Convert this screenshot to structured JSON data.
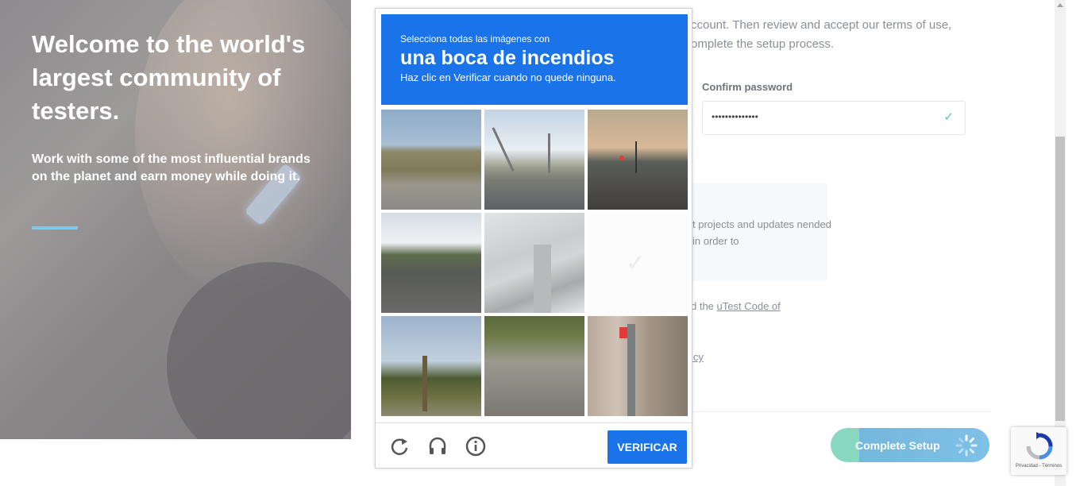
{
  "hero": {
    "title": "Welcome to the world's largest community of testers.",
    "subtitle": "Work with some of the most influential brands on the planet and earn money while doing it."
  },
  "form": {
    "intro": "ccount. Then review and accept our terms of use, omplete the setup process.",
    "confirm_password_label": "Confirm password",
    "confirm_password_value": "••••••••••••••",
    "info_text": "t projects and updates nended in order to",
    "code_prefix": "d the ",
    "code_link": "uTest Code of",
    "policy_text": "icy",
    "complete_setup_label": "Complete Setup"
  },
  "captcha": {
    "instruction_line1": "Selecciona todas las imágenes con",
    "target_object": "una boca de incendios",
    "instruction_line3": "Haz clic en Verificar cuando no quede ninguna.",
    "verify_label": "VERIFICAR",
    "footer_icons": [
      "reload-icon",
      "audio-icon",
      "info-icon"
    ]
  },
  "recaptcha_badge": {
    "links": "Privacidad - Términos"
  },
  "colors": {
    "captcha_blue": "#1a73e8",
    "accent_line": "#87c6e6",
    "setup_green": "#88d8c0",
    "setup_blue": "#74b7dd"
  }
}
